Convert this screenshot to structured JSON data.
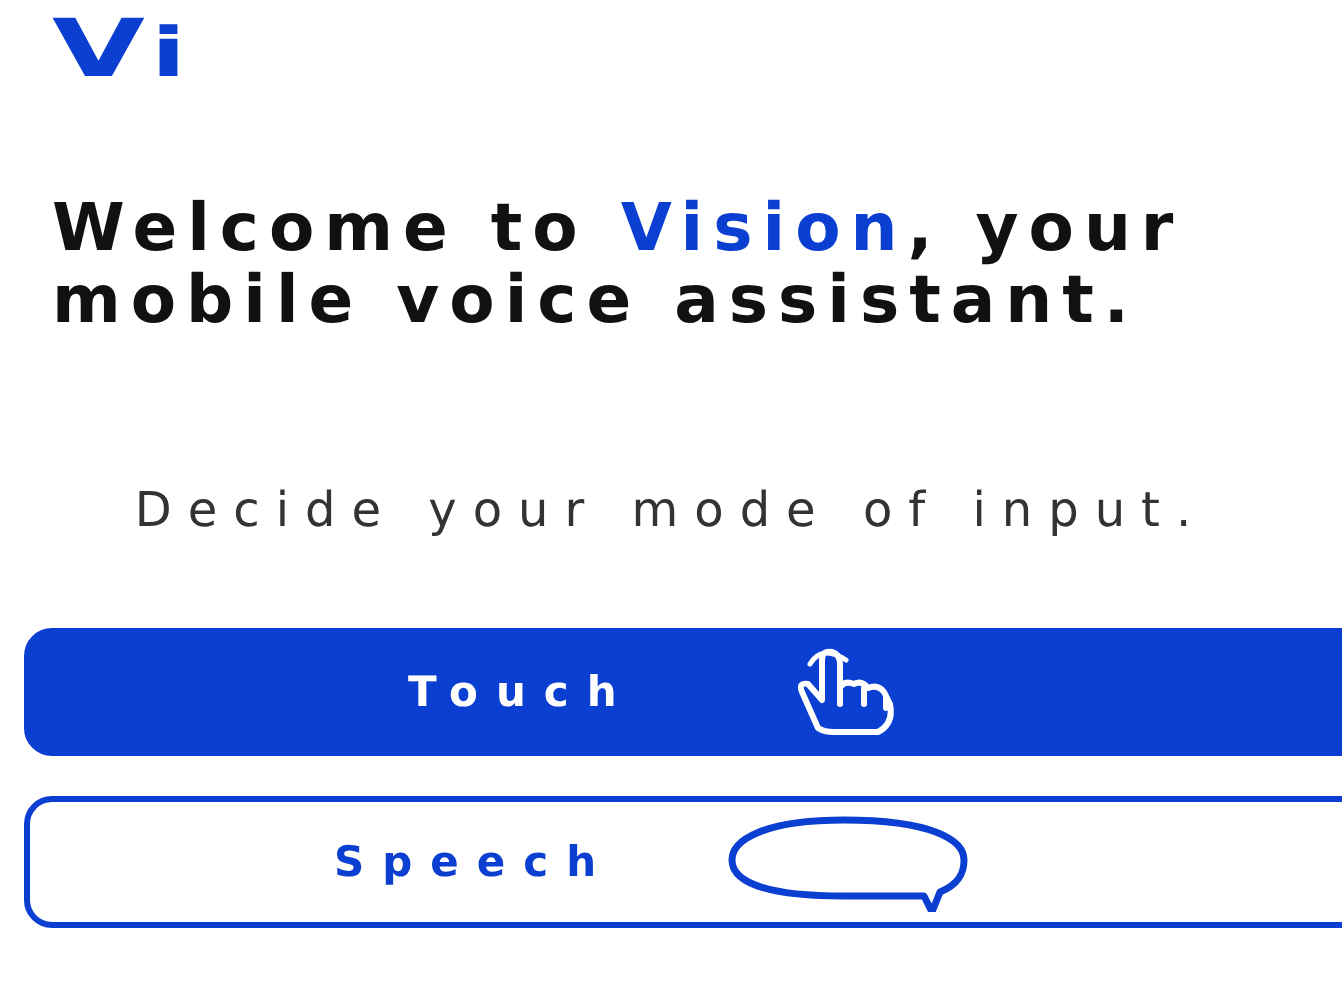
{
  "logo": "Vi",
  "heading": {
    "before": "Welcome to ",
    "highlight": "Vision",
    "after": ", your mobile voice assistant."
  },
  "prompt": "Decide your mode of input.",
  "buttons": [
    {
      "label": "Touch",
      "kind": "filled"
    },
    {
      "label": "Speech",
      "kind": "outlined"
    }
  ]
}
